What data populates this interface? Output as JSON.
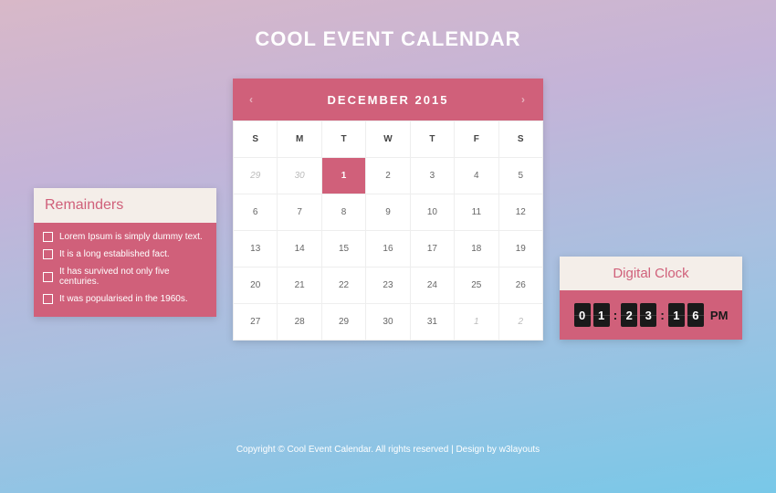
{
  "title": "COOL EVENT CALENDAR",
  "calendar": {
    "month_label": "December 2015",
    "nav_prev": "‹",
    "nav_next": "›",
    "weekdays": [
      "S",
      "M",
      "T",
      "W",
      "T",
      "F",
      "S"
    ],
    "weeks": [
      [
        {
          "n": "29",
          "muted": true
        },
        {
          "n": "30",
          "muted": true
        },
        {
          "n": "1",
          "today": true
        },
        {
          "n": "2"
        },
        {
          "n": "3"
        },
        {
          "n": "4"
        },
        {
          "n": "5"
        }
      ],
      [
        {
          "n": "6"
        },
        {
          "n": "7"
        },
        {
          "n": "8"
        },
        {
          "n": "9"
        },
        {
          "n": "10"
        },
        {
          "n": "11"
        },
        {
          "n": "12"
        }
      ],
      [
        {
          "n": "13"
        },
        {
          "n": "14"
        },
        {
          "n": "15"
        },
        {
          "n": "16"
        },
        {
          "n": "17"
        },
        {
          "n": "18"
        },
        {
          "n": "19"
        }
      ],
      [
        {
          "n": "20"
        },
        {
          "n": "21"
        },
        {
          "n": "22"
        },
        {
          "n": "23"
        },
        {
          "n": "24"
        },
        {
          "n": "25"
        },
        {
          "n": "26"
        }
      ],
      [
        {
          "n": "27"
        },
        {
          "n": "28"
        },
        {
          "n": "29"
        },
        {
          "n": "30"
        },
        {
          "n": "31"
        },
        {
          "n": "1",
          "muted": true
        },
        {
          "n": "2",
          "muted": true
        }
      ]
    ]
  },
  "remainders": {
    "title": "Remainders",
    "items": [
      "Lorem Ipsum is simply dummy text.",
      "It is a long established fact.",
      "It has survived not only five centuries.",
      "It was popularised in the 1960s."
    ]
  },
  "clock": {
    "title": "Digital Clock",
    "digits": [
      "0",
      "1",
      "2",
      "3",
      "1",
      "6"
    ],
    "colon": ":",
    "ampm": "PM"
  },
  "footer": {
    "copyright": "Copyright © Cool Event Calendar. All rights reserved | Design by ",
    "link": "w3layouts"
  }
}
